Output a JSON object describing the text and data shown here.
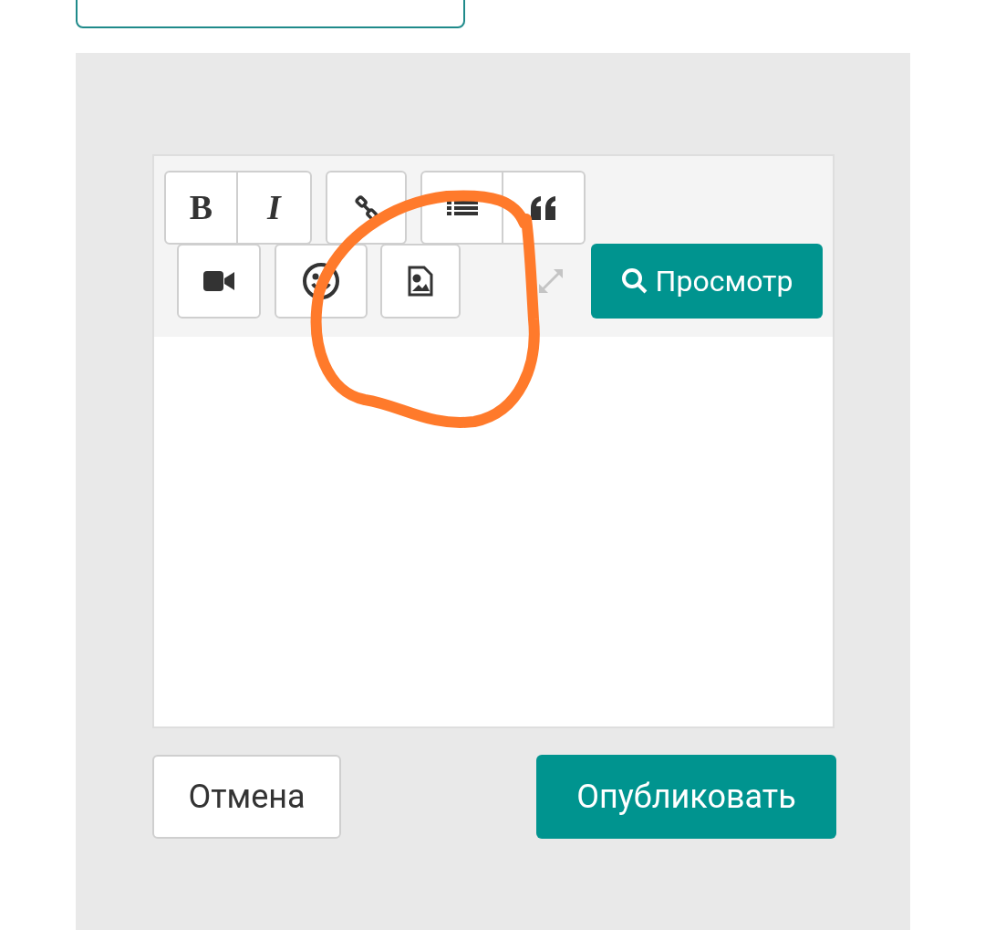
{
  "toolbar": {
    "format_buttons": [
      {
        "label": "B",
        "kind": "bold"
      },
      {
        "label": "I",
        "kind": "italic"
      }
    ],
    "preview_button": "Просмотр"
  },
  "actions": [
    {
      "label": "Отмена",
      "kind": "secondary"
    },
    {
      "label": "Опубликовать",
      "kind": "primary"
    }
  ]
}
